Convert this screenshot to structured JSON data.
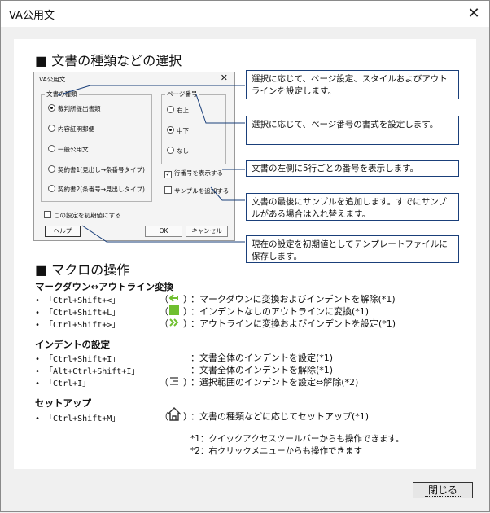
{
  "window": {
    "title": "VA公用文",
    "close_symbol": "✕"
  },
  "section1": {
    "heading": "■ 文書の種類などの選択"
  },
  "mini_dialog": {
    "title": "VA公用文",
    "close_symbol": "✕",
    "doc_type_group": "文書の種類",
    "doc_types": [
      "裁判所提出書類",
      "内容証明郵便",
      "一般公用文",
      "契約書1(見出し→条番号タイプ)",
      "契約書2(条番号→見出しタイプ)"
    ],
    "selected_doc_type": 0,
    "page_number_group": "ページ番号",
    "page_numbers": [
      "右上",
      "中下",
      "なし"
    ],
    "selected_page_number": 1,
    "show_line_numbers": {
      "label": "行番号を表示する",
      "checked": true
    },
    "add_sample": {
      "label": "サンプルを追加する",
      "checked": false
    },
    "set_default": {
      "label": "この設定を初期値にする",
      "checked": false
    },
    "help_label": "ヘルプ",
    "ok_label": "OK",
    "cancel_label": "キャンセル"
  },
  "callouts": [
    "選択に応じて、ページ設定、スタイルおよびアウトラインを設定します。",
    "選択に応じて、ページ番号の書式を設定します。",
    "文書の左側に5行ごとの番号を表示します。",
    "文書の最後にサンプルを追加します。すでにサンプルがある場合は入れ替えます。",
    "現在の設定を初期値としてテンプレートファイルに保存します。"
  ],
  "section2": {
    "heading": "■ マクロの操作"
  },
  "groups": [
    {
      "title": "マークダウン↔アウトライン変換",
      "items": [
        {
          "keys": "• 「Ctrl+Shift+<」",
          "icon": "arrow-left-icon",
          "desc": "：マークダウンに変換およびインデントを解除(*1)"
        },
        {
          "keys": "• 「Ctrl+Shift+L」",
          "icon": "square-icon",
          "desc": "：インデントなしのアウトラインに変換(*1)"
        },
        {
          "keys": "• 「Ctrl+Shift+>」",
          "icon": "double-arrow-right-icon",
          "desc": "：アウトラインに変換およびインデントを設定(*1)"
        }
      ]
    },
    {
      "title": "インデントの設定",
      "items": [
        {
          "keys": "• 「Ctrl+Shift+I」",
          "icon": "",
          "desc": "：文書全体のインデントを設定(*1)"
        },
        {
          "keys": "• 「Alt+Ctrl+Shift+I」",
          "icon": "",
          "desc": "：文書全体のインデントを解除(*1)"
        },
        {
          "keys": "• 「Ctrl+I」",
          "icon": "lines-icon",
          "desc": "：選択範囲のインデントを設定⇔解除(*2)"
        }
      ]
    },
    {
      "title": "セットアップ",
      "items": [
        {
          "keys": "• 「Ctrl+Shift+M」",
          "icon": "home-icon",
          "desc": "：文書の種類などに応じてセットアップ(*1)"
        }
      ]
    }
  ],
  "notes": [
    "*1：クイックアクセスツールバーからも操作できます。",
    "*2：右クリックメニューからも操作できます"
  ],
  "close_button": "閉じる",
  "colors": {
    "accent_green": "#6fbf2f",
    "callout_border": "#1a3f7a"
  }
}
